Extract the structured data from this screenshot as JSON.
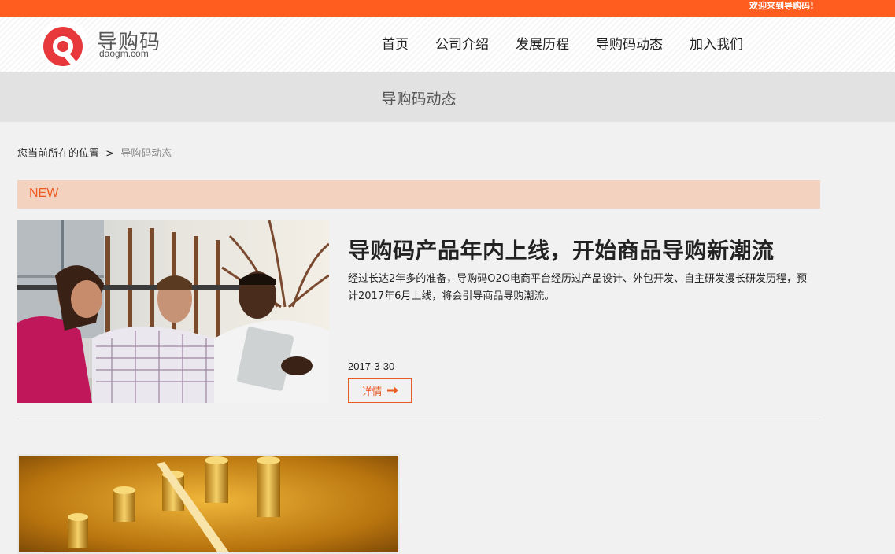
{
  "topbar": {
    "welcome": "欢迎来到导购码!"
  },
  "logo": {
    "name_cn": "导购码",
    "name_en": "daogm.com"
  },
  "nav": {
    "items": [
      {
        "label": "首页"
      },
      {
        "label": "公司介绍"
      },
      {
        "label": "发展历程"
      },
      {
        "label": "导购码动态"
      },
      {
        "label": "加入我们"
      }
    ]
  },
  "banner": {
    "title": "导购码动态"
  },
  "breadcrumb": {
    "prefix": "您当前所在的位置",
    "separator": ">",
    "current": "导购码动态"
  },
  "section": {
    "label": "NEW"
  },
  "articles": [
    {
      "title": "导购码产品年内上线，开始商品导购新潮流",
      "summary": "经过长达2年多的准备，导购码O2O电商平台经历过产品设计、外包开发、自主研发漫长研发历程，预计2017年6月上线，将会引导商品导购潮流。",
      "date": "2017-3-30",
      "detail_label": "详情"
    }
  ],
  "colors": {
    "accent": "#fe5d1f",
    "new_bar": "#f3d2bf",
    "banner": "#e2e2e2"
  }
}
